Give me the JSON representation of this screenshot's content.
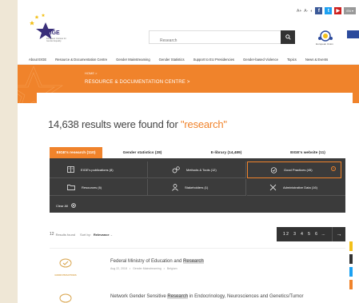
{
  "header": {
    "logo_name": "EIGE",
    "logo_sub": "European Institute for Gender Equality",
    "search_placeholder": "Research",
    "eu_text": "European Union",
    "util": [
      "A+",
      "A-",
      "◐"
    ],
    "lang": "EN"
  },
  "nav": {
    "items": [
      "About EIGE",
      "Resource & Documentation Centre",
      "Gender Mainstreaming",
      "Gender Statistics",
      "Support to EU Presidencies",
      "Gender-based Violence",
      "Topics",
      "News & Events"
    ]
  },
  "banner": {
    "breadcrumb": "HOME  >",
    "title": "RESOURCE & DOCUMENTATION CENTRE  >"
  },
  "results": {
    "prefix": "14,638 results were found for",
    "query": "\"research\""
  },
  "tabs": [
    "EIGE's research (110)",
    "Gender statistics (28)",
    "E-library (14,489)",
    "EIGE's website (11)"
  ],
  "filters": [
    {
      "label": "EIGE's publications (8)",
      "icon": "book-icon"
    },
    {
      "label": "Methods & Tools (12)",
      "icon": "gears-icon"
    },
    {
      "label": "Good Practices (45)",
      "icon": "checkmark-badge-icon"
    },
    {
      "label": "Resources (6)",
      "icon": "folder-icon"
    },
    {
      "label": "Stakeholders (1)",
      "icon": "person-icon"
    },
    {
      "label": "Administrative Data (16)",
      "icon": "tools-icon"
    }
  ],
  "clear_all": "Clear All",
  "sort": {
    "count": "12",
    "count_label": "Results found",
    "sort_by": "Sort by:",
    "sort_value": "Relevance"
  },
  "pager": [
    "1",
    "2",
    "3",
    "4",
    "5",
    "6",
    "..."
  ],
  "result_items": [
    {
      "badge": "GOOD PRACTICES",
      "title_pre": "Federal Ministry of Education and ",
      "title_hl": "Research",
      "title_post": "",
      "date": "Aug 22, 2018",
      "area": "Gender Mainstreaming",
      "country": "Belgium"
    },
    {
      "badge": "",
      "title_pre": "Network Gender Sensitive ",
      "title_hl": "Research",
      "title_post": " in Endocrinology, Neurosciences and Genetics/Tumor",
      "date": "",
      "area": "",
      "country": ""
    }
  ],
  "colors": {
    "accent": "#f0832b",
    "dark_panel": "#3b3b3b",
    "facebook": "#3b5998",
    "twitter": "#1da1f2",
    "youtube": "#cd201f"
  }
}
